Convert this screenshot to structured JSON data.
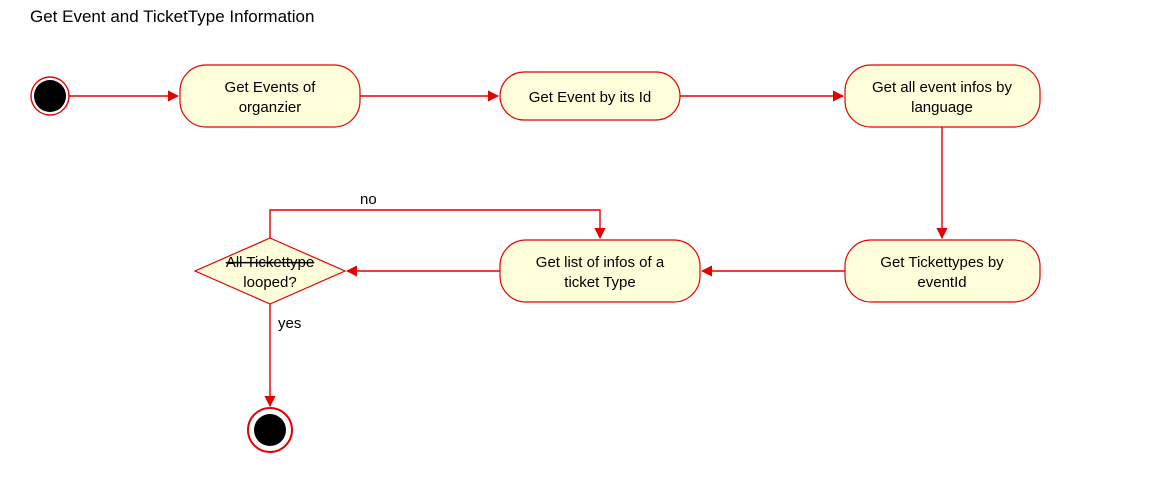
{
  "title": "Get Event and TicketType Information",
  "nodes": {
    "n1": {
      "line1": "Get Events of",
      "line2": "organzier"
    },
    "n2": {
      "line1": "Get Event by its Id"
    },
    "n3": {
      "line1": "Get all event infos by",
      "line2": "language"
    },
    "n4": {
      "line1": "Get Tickettypes by",
      "line2": "eventId"
    },
    "n5": {
      "line1": "Get list of infos of a",
      "line2": "ticket Type"
    },
    "decision": {
      "line1": "All Tickettype",
      "line2": "looped?"
    }
  },
  "edges": {
    "no": "no",
    "yes": "yes"
  },
  "chart_data": {
    "type": "activity-diagram",
    "title": "Get Event and TicketType Information",
    "nodes": [
      {
        "id": "start",
        "kind": "initial"
      },
      {
        "id": "n1",
        "kind": "action",
        "label": "Get Events of organzier"
      },
      {
        "id": "n2",
        "kind": "action",
        "label": "Get Event by its Id"
      },
      {
        "id": "n3",
        "kind": "action",
        "label": "Get all event infos by language"
      },
      {
        "id": "n4",
        "kind": "action",
        "label": "Get Tickettypes by eventId"
      },
      {
        "id": "n5",
        "kind": "action",
        "label": "Get list of infos of a ticket Type"
      },
      {
        "id": "d1",
        "kind": "decision",
        "label": "All Tickettype looped?"
      },
      {
        "id": "end",
        "kind": "final"
      }
    ],
    "edges": [
      {
        "from": "start",
        "to": "n1"
      },
      {
        "from": "n1",
        "to": "n2"
      },
      {
        "from": "n2",
        "to": "n3"
      },
      {
        "from": "n3",
        "to": "n4"
      },
      {
        "from": "n4",
        "to": "n5"
      },
      {
        "from": "n5",
        "to": "d1"
      },
      {
        "from": "d1",
        "to": "n5",
        "label": "no"
      },
      {
        "from": "d1",
        "to": "end",
        "label": "yes"
      }
    ]
  }
}
